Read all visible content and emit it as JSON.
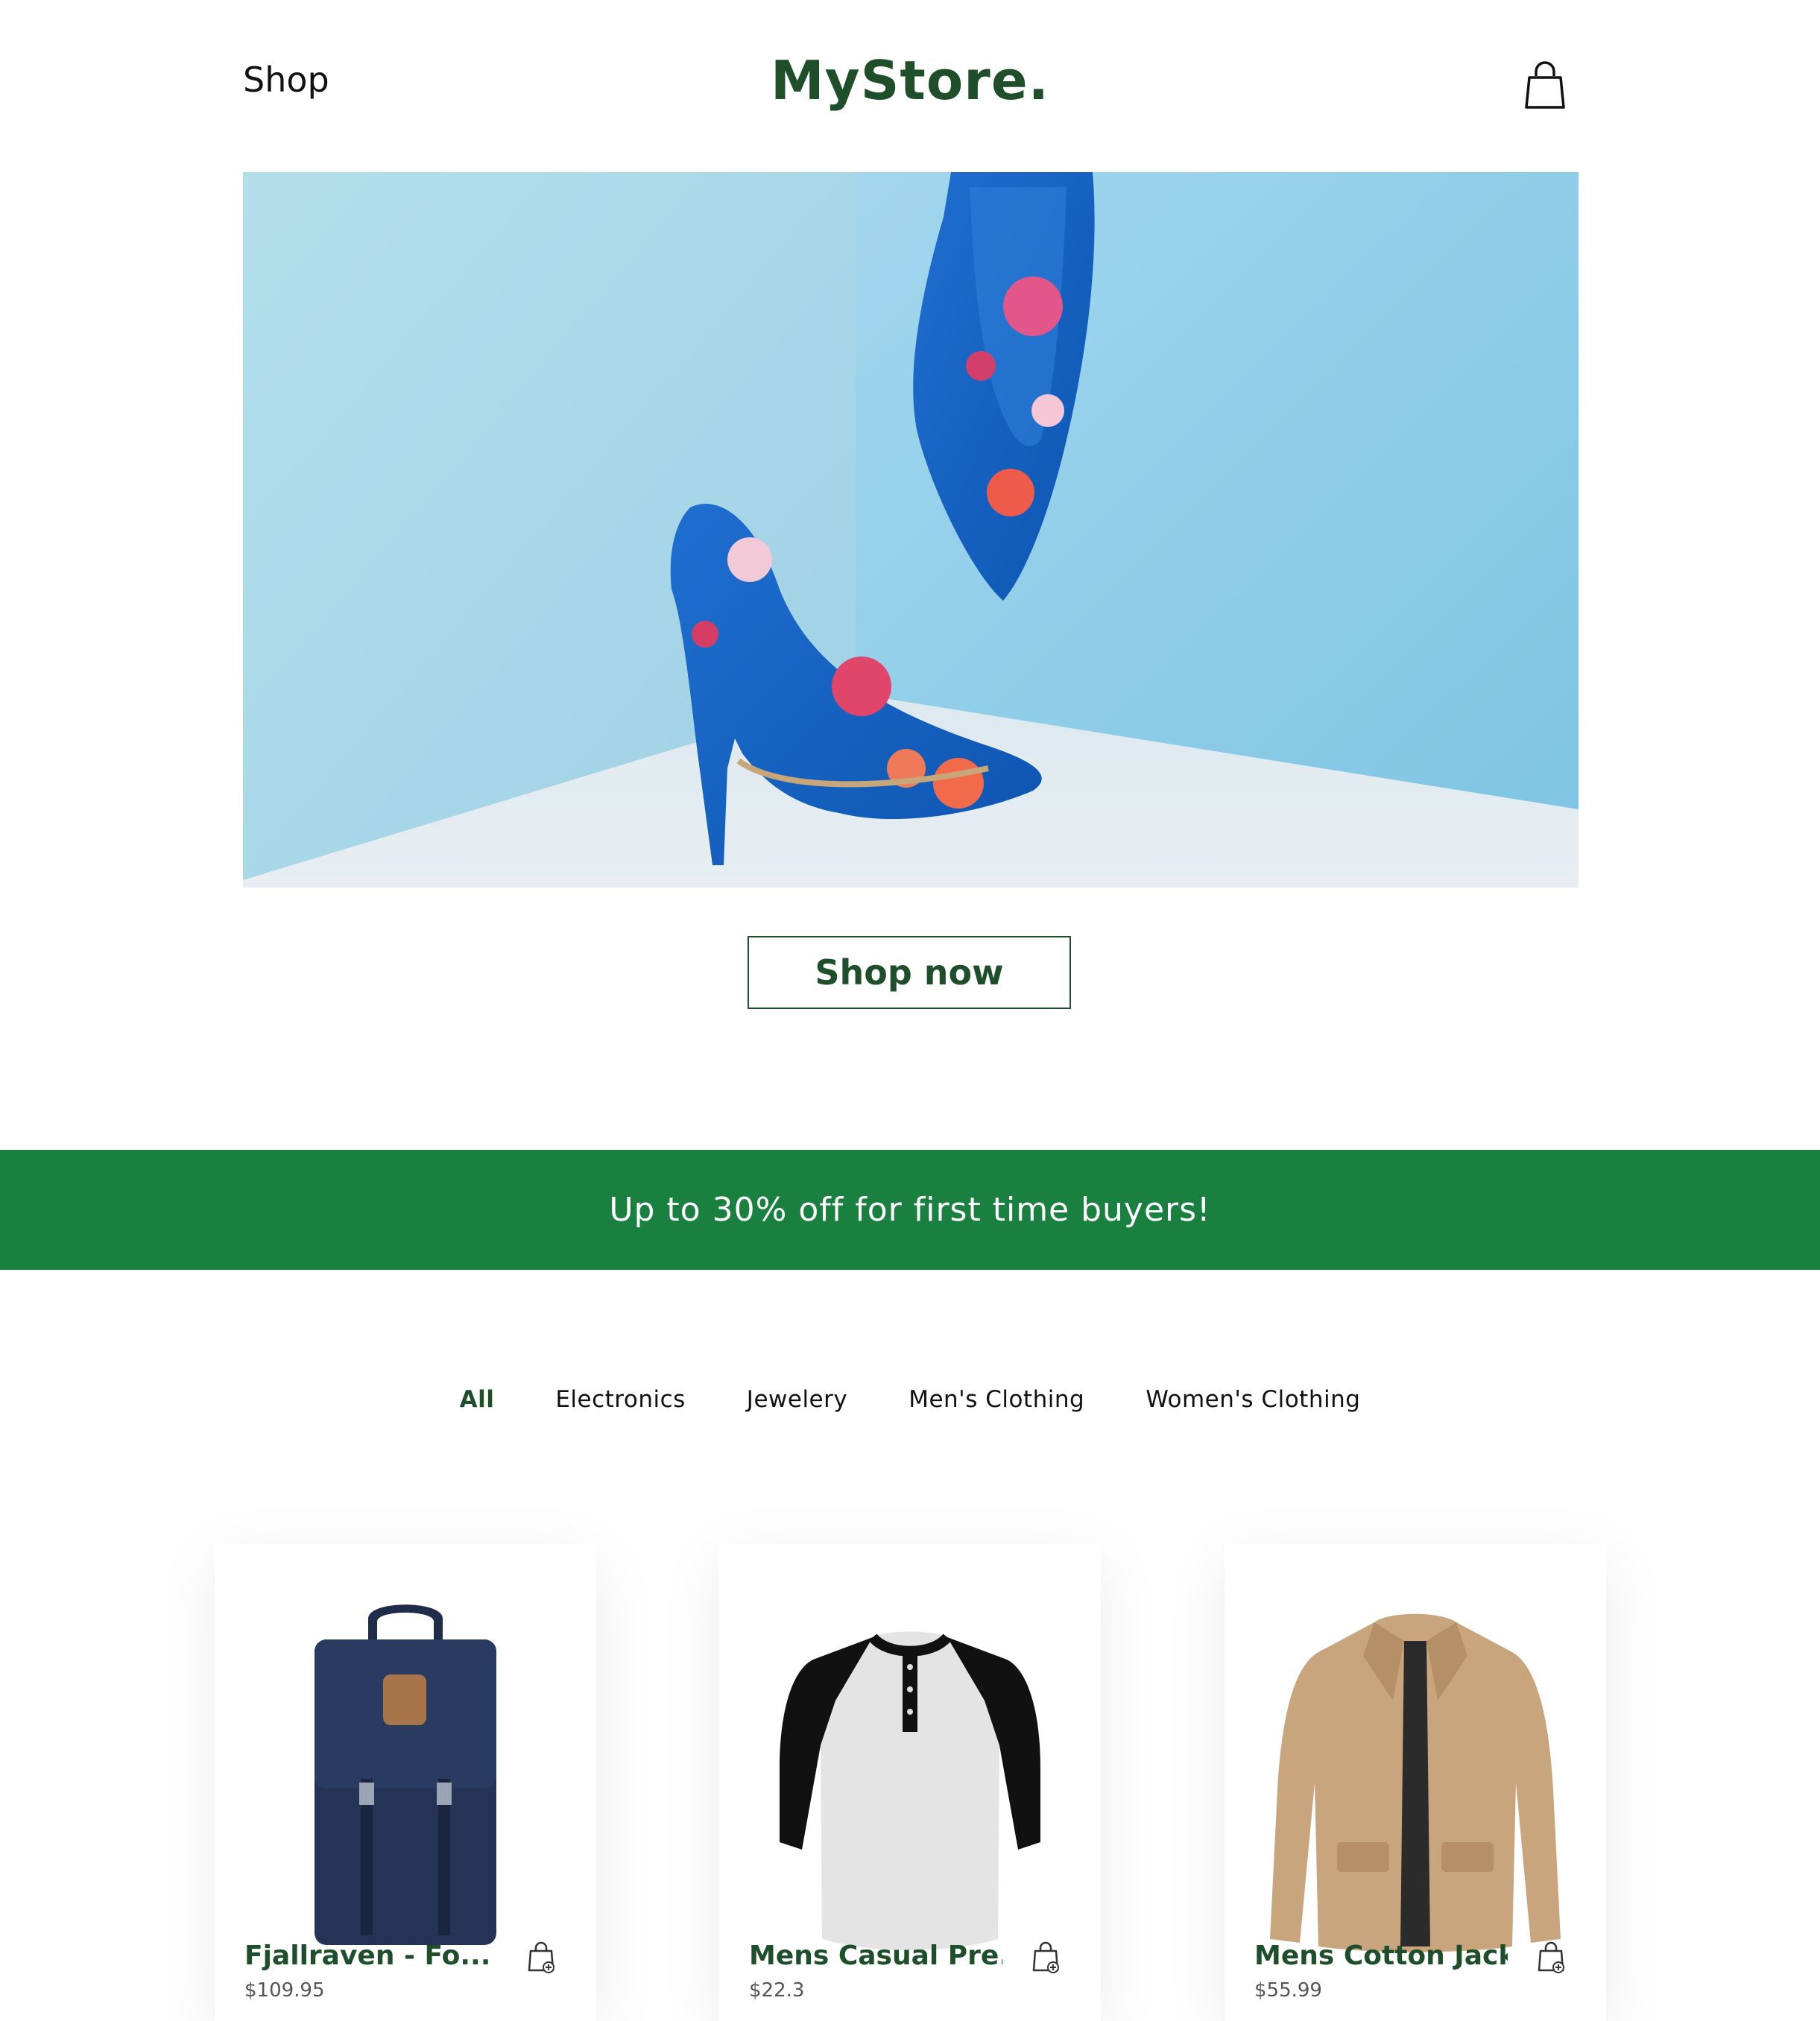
{
  "header": {
    "nav_shop": "Shop",
    "brand": "MyStore.",
    "cart_icon": "shopping-bag-icon"
  },
  "hero": {
    "image": "floral-high-heel-shoes-photo",
    "cta_label": "Shop now"
  },
  "promo": {
    "text": "Up to 30% off for first time buyers!"
  },
  "categories": {
    "items": [
      "All",
      "Electronics",
      "Jewelery",
      "Men's Clothing",
      "Women's Clothing"
    ],
    "active": "All"
  },
  "products": [
    {
      "title": "Fjallraven - Fo...",
      "price": "$109.95",
      "image": "navy-backpack",
      "add_icon": "add-to-cart-icon"
    },
    {
      "title": "Mens Casual Pre...",
      "price": "$22.3",
      "image": "raglan-henley-shirt",
      "add_icon": "add-to-cart-icon"
    },
    {
      "title": "Mens Cotton Jacket",
      "price": "$55.99",
      "image": "khaki-cotton-jacket",
      "add_icon": "add-to-cart-icon"
    }
  ],
  "colors": {
    "brand_green": "#1e4f2a",
    "promo_green": "#1a803f",
    "hero_bg": "#9fd6ea"
  }
}
